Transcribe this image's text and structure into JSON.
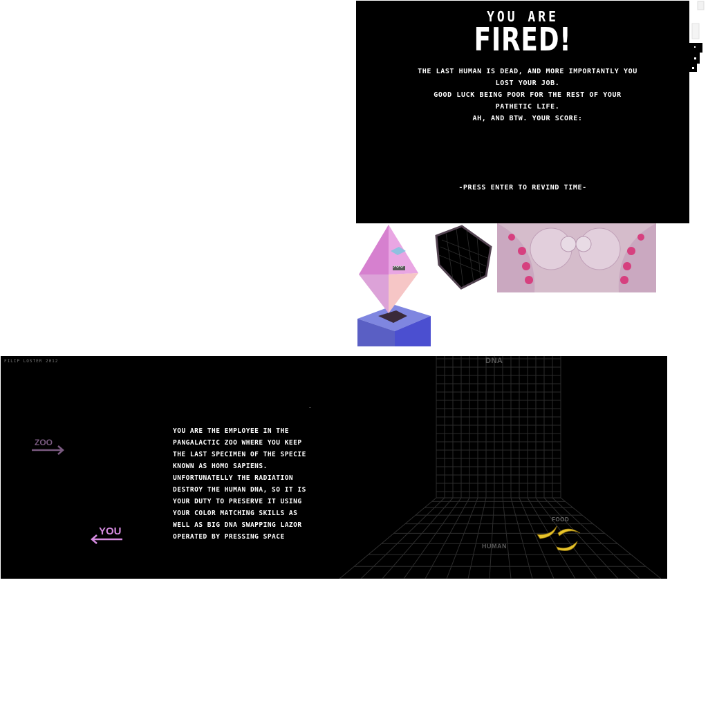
{
  "game_over": {
    "heading_small": "YOU ARE",
    "heading_big": "FIRED!",
    "message_lines": [
      "THE LAST HUMAN IS DEAD, AND MORE IMPORTANTLY YOU LOST YOUR JOB.",
      "GOOD LUCK BEING POOR FOR THE REST OF YOUR PATHETIC LIFE.",
      "AH, AND BTW. YOUR SCORE:"
    ],
    "prompt": "-PRESS ENTER TO REVIND TIME-"
  },
  "sprites": {
    "alien_icon": "pink-diamond-alien-icon",
    "cube_icon": "dark-wireframe-cube-icon",
    "dna_pod_icon": "pink-dna-pod-icon"
  },
  "game": {
    "credit": "FILIP LOSTER 2012",
    "story_lines": [
      "YOU ARE THE EMPLOYEE IN THE",
      "PANGALACTIC ZOO WHERE YOU KEEP",
      "THE LAST SPECIMEN OF THE SPECIE",
      "KNOWN AS HOMO SAPIENS.",
      "UNFORTUNATELLY THE RADIATION",
      "DESTROY THE HUMAN DNA, SO IT IS",
      "YOUR DUTY TO PRESERVE IT USING",
      "YOUR COLOR MATCHING SKILLS AS",
      "WELL AS BIG DNA SWAPPING LAZOR",
      "OPERATED BY PRESSING SPACE"
    ],
    "zoo_label": "ZOO",
    "you_label": "YOU",
    "dna_label": "DNA",
    "human_label": "HUMAN",
    "food_label": "FOOD",
    "colors": {
      "zoo_arrow": "#7a5a80",
      "you_arrow": "#d58be0",
      "grid": "#3a3a3a",
      "banana": "#e8c42a"
    }
  }
}
